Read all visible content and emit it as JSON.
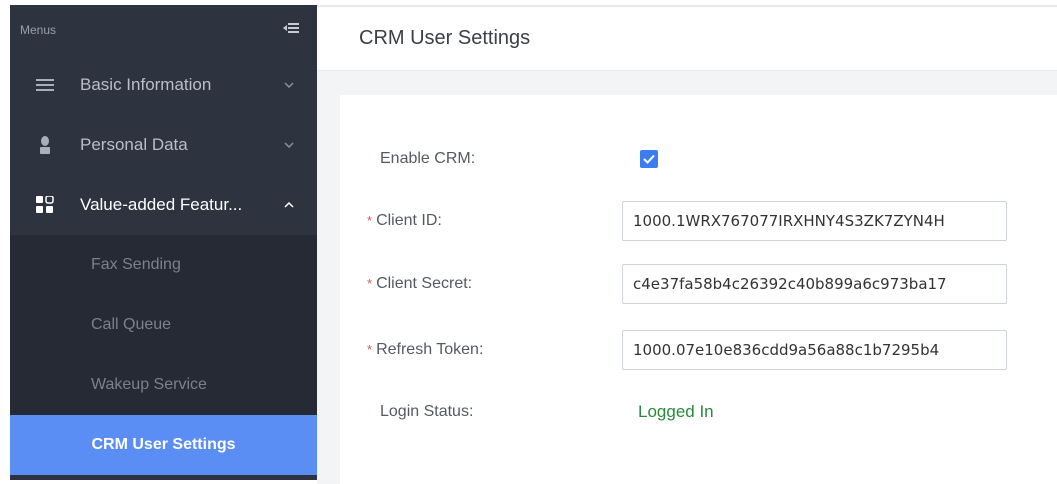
{
  "sidebar": {
    "header_label": "Menus",
    "items": [
      {
        "label": "Basic Information",
        "icon": "list-icon"
      },
      {
        "label": "Personal Data",
        "icon": "user-icon"
      },
      {
        "label": "Value-added Featur...",
        "icon": "grid-icon"
      }
    ],
    "sub_items": [
      {
        "label": "Fax Sending"
      },
      {
        "label": "Call Queue"
      },
      {
        "label": "Wakeup Service"
      },
      {
        "label": "CRM User Settings"
      }
    ]
  },
  "page": {
    "title": "CRM User Settings"
  },
  "form": {
    "enable_crm_label": "Enable CRM:",
    "enable_crm_checked": true,
    "client_id_label": "Client ID:",
    "client_id_value": "1000.1WRX767077IRXHNY4S3ZK7ZYN4H",
    "client_secret_label": "Client Secret:",
    "client_secret_value": "c4e37fa58b4c26392c40b899a6c973ba17",
    "refresh_token_label": "Refresh Token:",
    "refresh_token_value": "1000.07e10e836cdd9a56a88c1b7295b4",
    "login_status_label": "Login Status:",
    "login_status_value": "Logged In",
    "required_marker": "*"
  },
  "colors": {
    "sidebar_bg": "#2e3340",
    "active_item_bg": "#5b8ef5",
    "checkbox": "#3d7cf0",
    "status_ok": "#2a8a3a",
    "required": "#e0524f"
  }
}
